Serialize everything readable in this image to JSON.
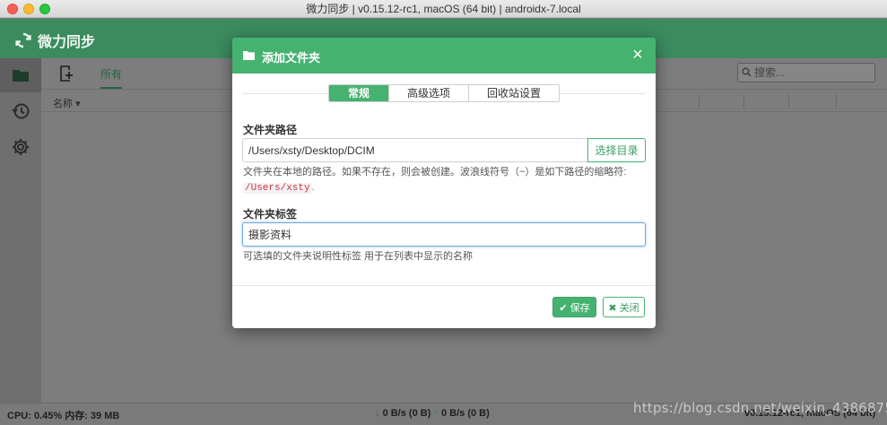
{
  "window": {
    "title": "微力同步 | v0.15.12-rc1, macOS (64 bit) | androidx-7.local"
  },
  "app": {
    "brand": "微力同步"
  },
  "toolbar": {
    "tab_all": "所有",
    "search_placeholder": "搜索..."
  },
  "list": {
    "column_name": "名称"
  },
  "statusbar": {
    "cpu_mem": "CPU: 0.45% 内存: 39 MB",
    "down_rate": "0 B/s (0 B)",
    "up_rate": "0 B/s (0 B)",
    "right_text": "v0.15.12-rc1, macOS (64 bit)"
  },
  "watermark": "https://blog.csdn.net/weixin_43868754",
  "dialog": {
    "title": "添加文件夹",
    "close_symbol": "×",
    "tabs": [
      "常规",
      "高级选项",
      "回收站设置"
    ],
    "path_label": "文件夹路径",
    "path_value": "/Users/xsty/Desktop/DCIM",
    "choose_dir": "选择目录",
    "path_help": "文件夹在本地的路径。如果不存在，则会被创建。波浪线符号（~）是如下路径的缩略符:",
    "path_help_code": "/Users/xsty",
    "path_help_end": ".",
    "label_label": "文件夹标签",
    "label_value": "摄影资料",
    "label_help": "可选填的文件夹说明性标签 用于在列表中显示的名称",
    "save": "保存",
    "close": "关闭"
  },
  "colors": {
    "accent": "#45b270",
    "header_dim": "#3c8b5f",
    "overlay_gray": "#7a7a7a"
  },
  "icons": [
    "sync-logo-icon",
    "folder-icon",
    "history-icon",
    "gear-icon",
    "add-folder-icon",
    "search-icon",
    "close-icon",
    "check-icon",
    "x-icon"
  ]
}
